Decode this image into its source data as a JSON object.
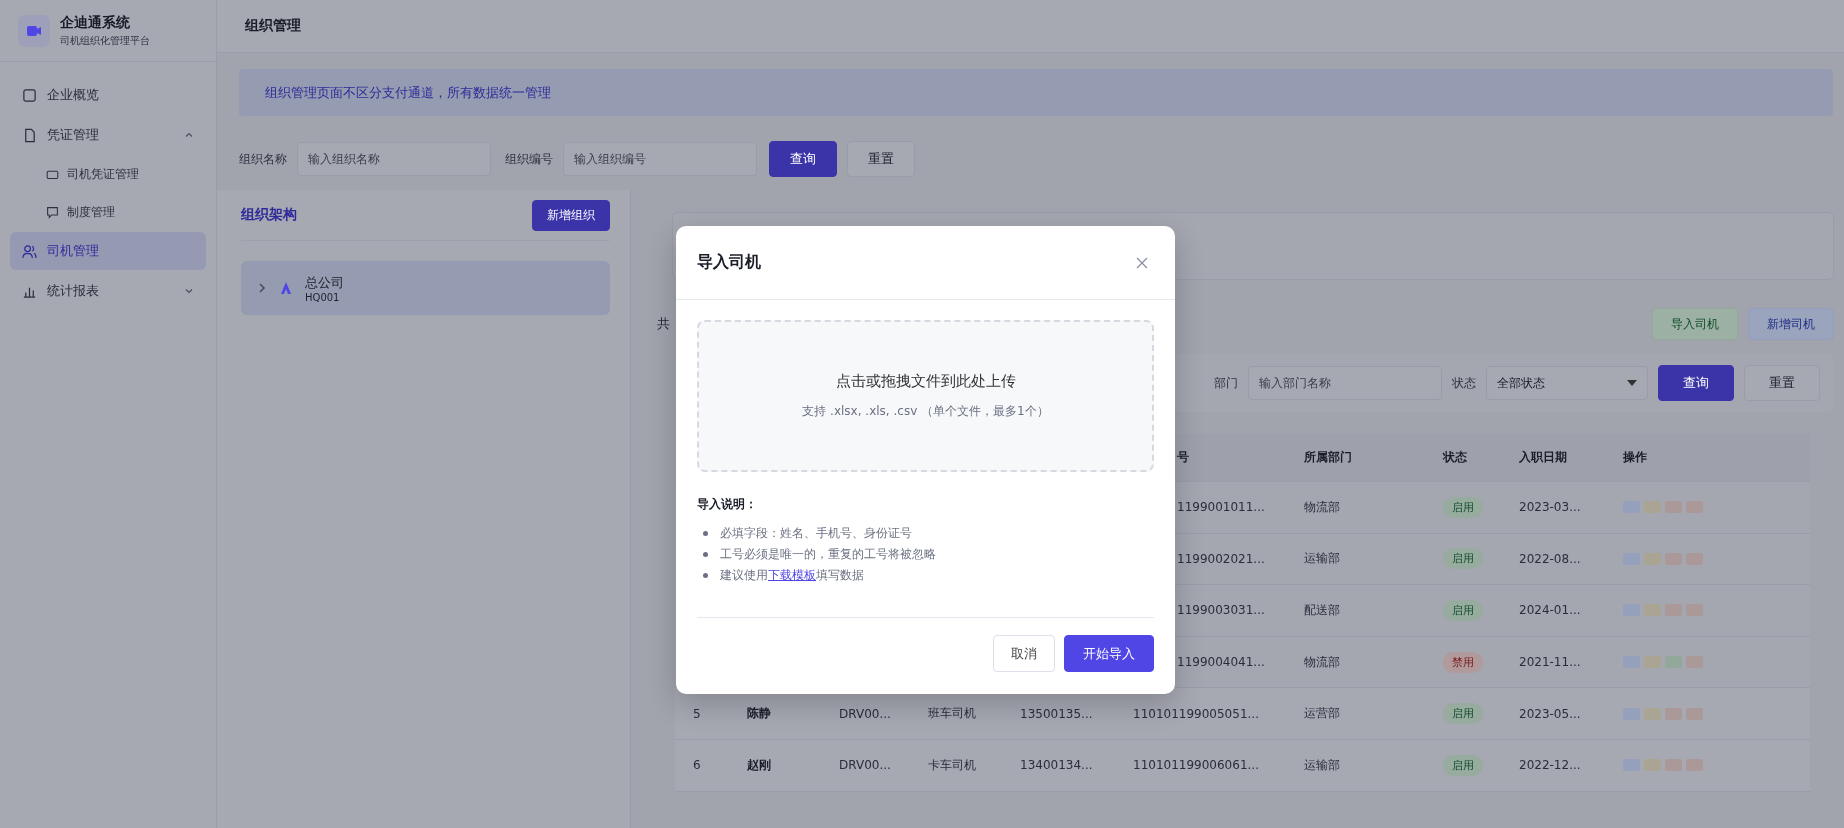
{
  "sidebar": {
    "logo_title": "企迪通系统",
    "logo_subtitle": "司机组织化管理平台",
    "items": [
      {
        "label": "企业概览",
        "selected": false
      },
      {
        "label": "凭证管理",
        "selected": false,
        "expanded": true,
        "children": [
          {
            "label": "司机凭证管理",
            "selected": false
          },
          {
            "label": "制度管理",
            "selected": false
          }
        ]
      },
      {
        "label": "司机管理",
        "selected": true
      },
      {
        "label": "统计报表",
        "selected": false,
        "expanded": false
      }
    ]
  },
  "page_title": "组织管理",
  "notice": "组织管理页面不区分支付通道，所有数据统一管理",
  "org_filter": {
    "fields": [
      {
        "label": "组织名称",
        "placeholder": "输入组织名称"
      },
      {
        "label": "组织编号",
        "placeholder": "输入组织编号"
      }
    ],
    "buttons": [
      "查询",
      "重置"
    ]
  },
  "org_panel": {
    "title": "组织架构",
    "add_button": "新增组织",
    "tree": [
      {
        "name": "总公司",
        "code": "HQ001",
        "selected": true,
        "expanded": false
      }
    ]
  },
  "driver_panel": {
    "count_text": "共",
    "actions": [
      {
        "label": "导入司机",
        "kind": "success"
      },
      {
        "label": "新增司机",
        "kind": "info"
      }
    ],
    "filter": {
      "dept": {
        "label": "部门",
        "placeholder": "输入部门名称"
      },
      "status": {
        "label": "状态",
        "value": "全部状态"
      },
      "buttons": [
        "查询",
        "重置"
      ]
    },
    "table": {
      "columns": [
        {},
        {},
        {},
        {},
        {},
        {
          "label": "号"
        },
        {
          "label": "所属部门"
        },
        {
          "label": "状态"
        },
        {
          "label": "入职日期"
        },
        {
          "label": "操作"
        }
      ],
      "rows": [
        {
          "covered": true,
          "id_no": "1199001011...",
          "dept": "物流部",
          "status": {
            "text": "启用",
            "kind": "ok"
          },
          "date": "2023-03...",
          "actions": [
            {
              "color": "#94a0bc"
            },
            {
              "color": "#aaa492"
            },
            {
              "color": "#ab9899"
            },
            {
              "color": "#ab9899"
            }
          ]
        },
        {
          "covered": true,
          "id_no": "1199002021...",
          "dept": "运输部",
          "status": {
            "text": "启用",
            "kind": "ok"
          },
          "date": "2022-08...",
          "actions": [
            {
              "color": "#94a0bc"
            },
            {
              "color": "#aaa492"
            },
            {
              "color": "#ab9899"
            },
            {
              "color": "#ab9899"
            }
          ]
        },
        {
          "covered": true,
          "id_no": "1199003031...",
          "dept": "配送部",
          "status": {
            "text": "启用",
            "kind": "ok"
          },
          "date": "2024-01...",
          "actions": [
            {
              "color": "#94a0bc"
            },
            {
              "color": "#aaa492"
            },
            {
              "color": "#ab9899"
            },
            {
              "color": "#ab9899"
            }
          ]
        },
        {
          "covered": true,
          "id_no": "1199004041...",
          "dept": "物流部",
          "status": {
            "text": "禁用",
            "kind": "off"
          },
          "date": "2021-11...",
          "actions": [
            {
              "color": "#94a0bc"
            },
            {
              "color": "#aaa492"
            },
            {
              "color": "#92a89a"
            },
            {
              "color": "#ab9899"
            }
          ]
        },
        {
          "covered": false,
          "index": "5",
          "name": "陈静",
          "emp_id": "DRV00...",
          "type": "班车司机",
          "phone": "13500135...",
          "id_no": "110101199005051...",
          "dept": "运营部",
          "status": {
            "text": "启用",
            "kind": "ok"
          },
          "date": "2023-05...",
          "actions": [
            {
              "color": "#94a0bc"
            },
            {
              "color": "#aaa492"
            },
            {
              "color": "#ab9899"
            },
            {
              "color": "#ab9899"
            }
          ]
        },
        {
          "covered": false,
          "index": "6",
          "name": "赵刚",
          "emp_id": "DRV00...",
          "type": "卡车司机",
          "phone": "13400134...",
          "id_no": "110101199006061...",
          "dept": "运输部",
          "status": {
            "text": "启用",
            "kind": "ok"
          },
          "date": "2022-12...",
          "actions": [
            {
              "color": "#94a0bc"
            },
            {
              "color": "#aaa492"
            },
            {
              "color": "#ab9899"
            },
            {
              "color": "#ab9899"
            }
          ]
        }
      ]
    }
  },
  "modal": {
    "title": "导入司机",
    "upload": {
      "main": "点击或拖拽文件到此处上传",
      "hint": "支持 .xlsx, .xls, .csv （单个文件，最多1个）"
    },
    "notes_title": "导入说明：",
    "notes": [
      {
        "text": "必填字段：姓名、手机号、身份证号"
      },
      {
        "text": "工号必须是唯一的，重复的工号将被忽略"
      },
      {
        "text": "建议使用",
        "link": "下载模板",
        "after": "填写数据"
      }
    ],
    "buttons": [
      {
        "label": "取消",
        "kind": "secondary"
      },
      {
        "label": "开始导入",
        "kind": "primary"
      }
    ]
  }
}
